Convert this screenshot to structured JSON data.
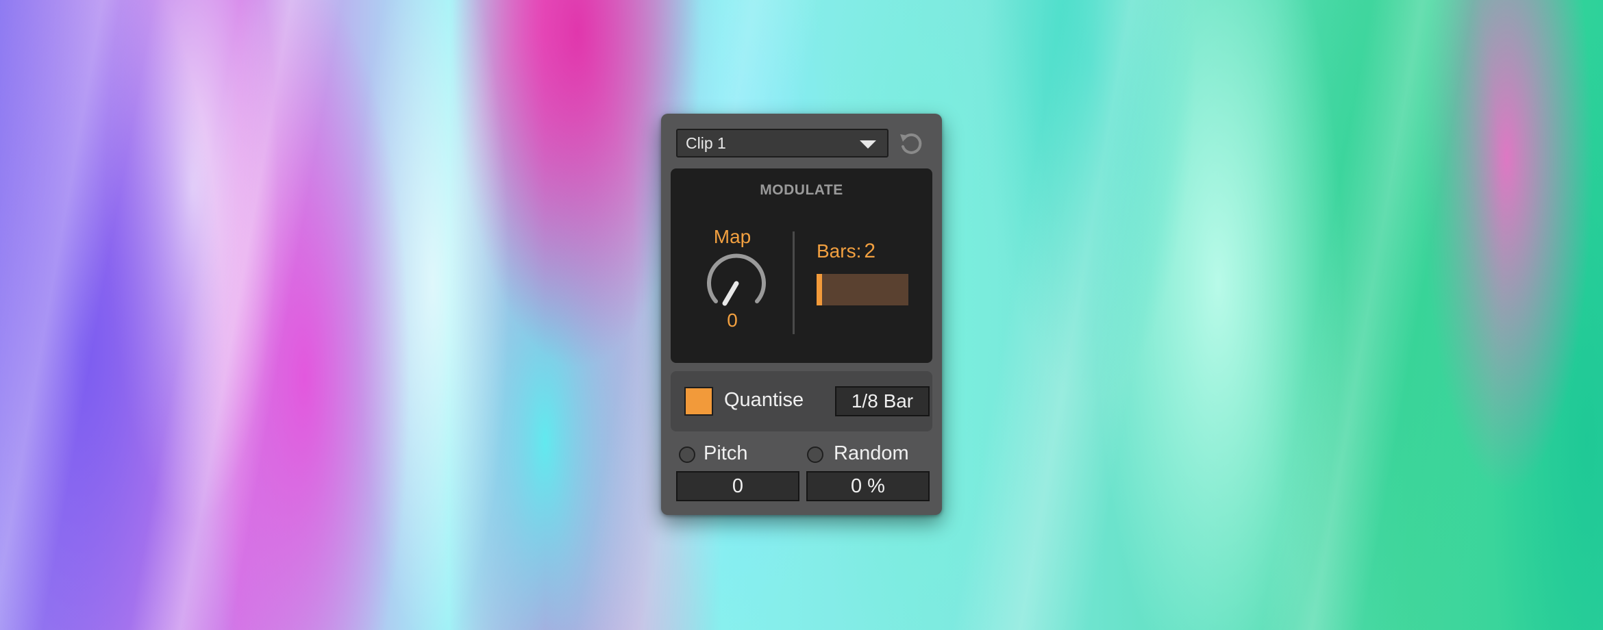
{
  "device": {
    "clip_selector": {
      "value": "Clip 1"
    },
    "reset_button": {
      "icon": "reset-icon"
    },
    "modulate": {
      "title": "MODULATE",
      "map": {
        "label": "Map",
        "value": "0"
      },
      "bars": {
        "label": "Bars:",
        "value": "2",
        "slider_level": 0.06
      }
    },
    "quantise": {
      "enabled": true,
      "label": "Quantise",
      "value": "1/8 Bar"
    },
    "pitch": {
      "label": "Pitch",
      "value": "0"
    },
    "random": {
      "label": "Random",
      "value": "0 %"
    }
  },
  "colors": {
    "accent": "#f29a3a",
    "panel": "#555556",
    "section_bg": "#1e1e1e",
    "text": "#f0f0f0"
  }
}
